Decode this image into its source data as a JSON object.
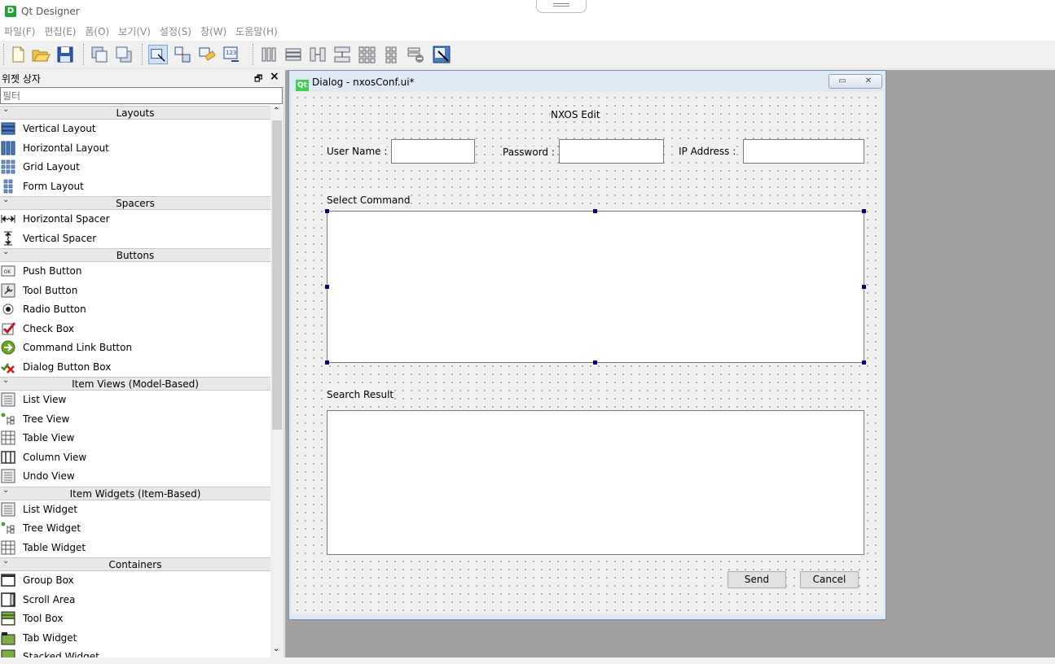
{
  "app": {
    "title": "Qt Designer",
    "icon": "designer-app-icon"
  },
  "menubar": {
    "items": [
      "파일(F)",
      "편집(E)",
      "폼(O)",
      "보기(V)",
      "설정(S)",
      "창(W)",
      "도움말(H)"
    ]
  },
  "toolbar": {
    "buttons": [
      "new-form-icon",
      "open-icon",
      "save-icon",
      "send-to-back-icon",
      "bring-to-front-icon",
      "edit-widgets-icon",
      "edit-signals-slots-icon",
      "edit-buddies-icon",
      "edit-tab-order-icon",
      "lay-out-horizontally-icon",
      "lay-out-vertically-icon",
      "lay-out-horizontal-splitter-icon",
      "lay-out-vertical-splitter-icon",
      "lay-out-grid-icon",
      "lay-out-form-icon",
      "break-layout-icon",
      "adjust-size-icon"
    ]
  },
  "widget_box": {
    "title": "위젯 상자",
    "filter_placeholder": "필터",
    "categories": [
      {
        "label": "Layouts",
        "items": [
          "Vertical Layout",
          "Horizontal Layout",
          "Grid Layout",
          "Form Layout"
        ]
      },
      {
        "label": "Spacers",
        "items": [
          "Horizontal Spacer",
          "Vertical Spacer"
        ]
      },
      {
        "label": "Buttons",
        "items": [
          "Push Button",
          "Tool Button",
          "Radio Button",
          "Check Box",
          "Command Link Button",
          "Dialog Button Box"
        ]
      },
      {
        "label": "Item Views (Model-Based)",
        "items": [
          "List View",
          "Tree View",
          "Table View",
          "Column View",
          "Undo View"
        ]
      },
      {
        "label": "Item Widgets (Item-Based)",
        "items": [
          "List Widget",
          "Tree Widget",
          "Table Widget"
        ]
      },
      {
        "label": "Containers",
        "items": [
          "Group Box",
          "Scroll Area",
          "Tool Box",
          "Tab Widget",
          "Stacked Widget"
        ]
      }
    ]
  },
  "dialog": {
    "window_title": "Dialog - nxosConf.ui*",
    "heading": "NXOS  Edit",
    "user_name_label": "User  Name :",
    "password_label": "Password :",
    "ip_address_label": "IP  Address :",
    "user_name_value": "",
    "password_value": "",
    "ip_address_value": "",
    "select_command_label": "Select Command",
    "search_result_label": "Search  Result",
    "send_label": "Send",
    "cancel_label": "Cancel"
  },
  "colors": {
    "selection_handle": "#000080",
    "mdi_background": "#a0a0a0",
    "subwindow_frame": "#dfe9f5"
  }
}
